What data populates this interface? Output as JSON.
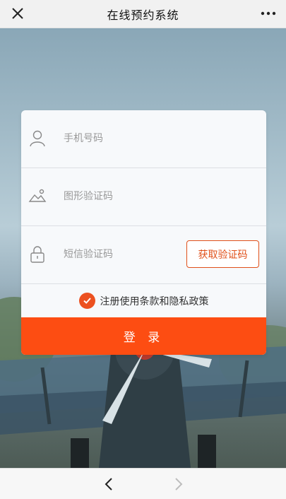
{
  "header": {
    "title": "在线预约系统",
    "close_icon": "close-icon",
    "more_icon": "more-icon"
  },
  "form": {
    "phone": {
      "placeholder": "手机号码",
      "value": "",
      "icon": "user-icon"
    },
    "captcha": {
      "placeholder": "图形验证码",
      "value": "",
      "icon": "image-icon"
    },
    "sms": {
      "placeholder": "短信验证码",
      "value": "",
      "icon": "lock-icon",
      "button_label": "获取验证码"
    },
    "agreement": {
      "checked": true,
      "label": "注册使用条款和隐私政策"
    },
    "login_label": "登 录"
  },
  "colors": {
    "accent": "#fd4d12",
    "accent_border": "#e0501a",
    "check": "#ec5120"
  },
  "footer": {
    "back_icon": "chevron-left-icon",
    "forward_icon": "chevron-right-icon"
  }
}
